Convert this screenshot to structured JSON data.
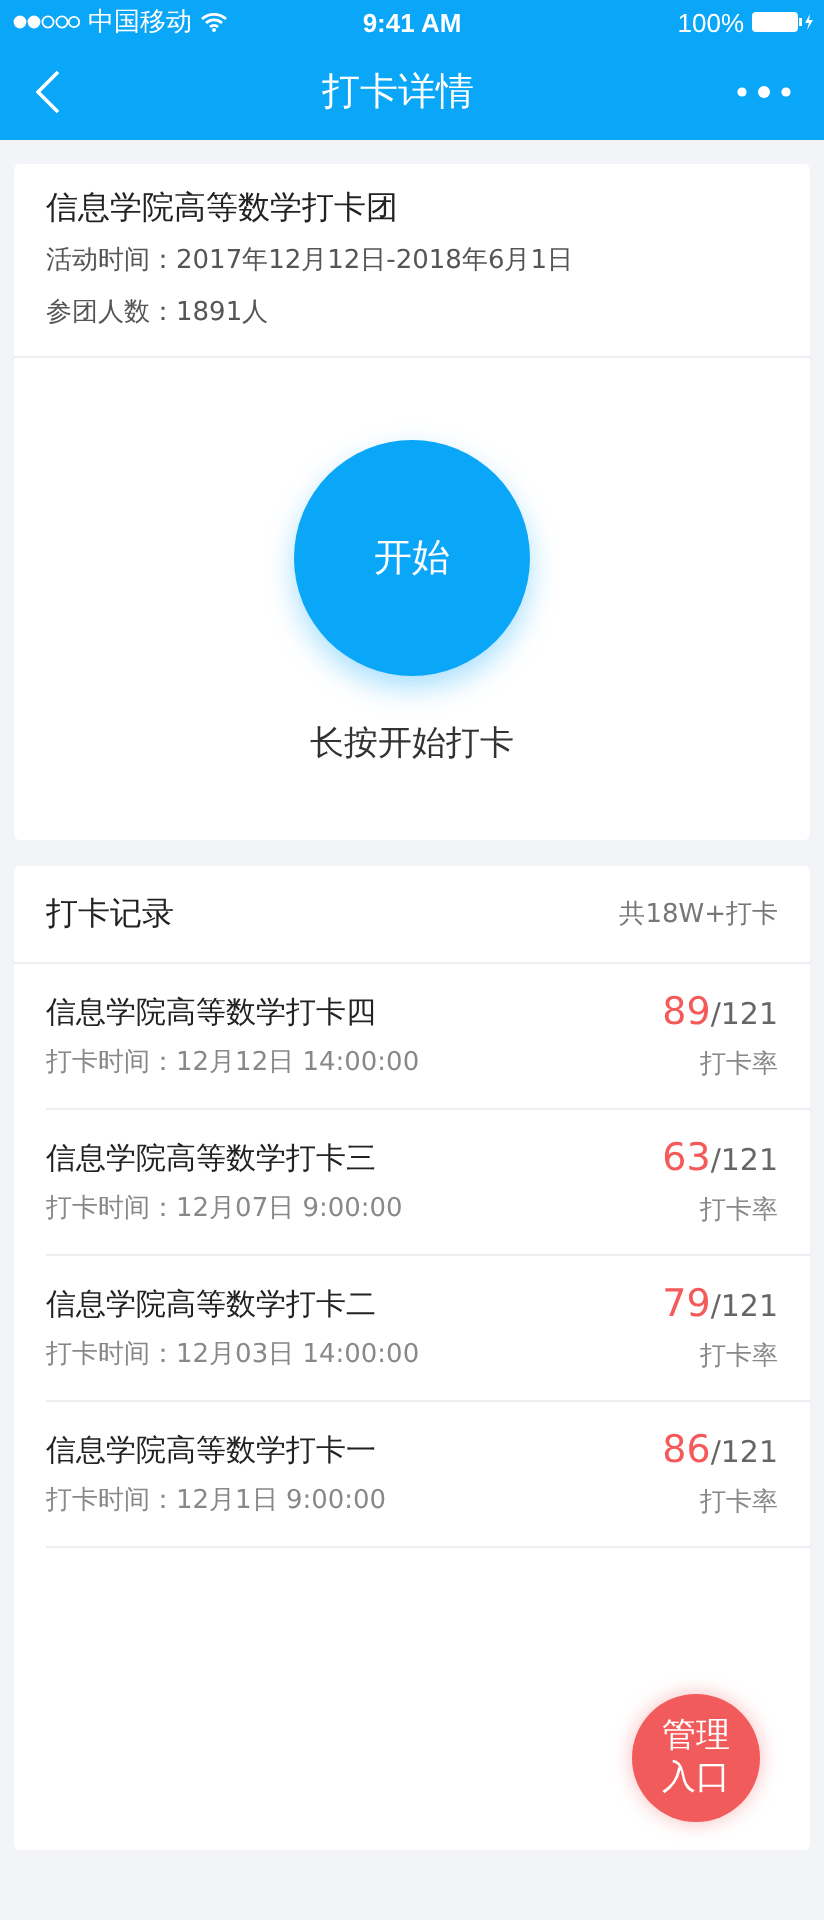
{
  "status_bar": {
    "carrier": "中国移动",
    "time": "9:41 AM",
    "battery": "100%"
  },
  "nav": {
    "title": "打卡详情"
  },
  "group": {
    "name": "信息学院高等数学打卡团",
    "period": "活动时间：2017年12月12日-2018年6月1日",
    "members": "参团人数：1891人"
  },
  "start": {
    "button": "开始",
    "hint": "长按开始打卡"
  },
  "records": {
    "title": "打卡记录",
    "total": "共18W+打卡",
    "items": [
      {
        "name": "信息学院高等数学打卡四",
        "time": "打卡时间：12月12日 14:00:00",
        "count": "89",
        "total": "/121",
        "rate_label": "打卡率"
      },
      {
        "name": "信息学院高等数学打卡三",
        "time": "打卡时间：12月07日 9:00:00",
        "count": "63",
        "total": "/121",
        "rate_label": "打卡率"
      },
      {
        "name": "信息学院高等数学打卡二",
        "time": "打卡时间：12月03日 14:00:00",
        "count": "79",
        "total": "/121",
        "rate_label": "打卡率"
      },
      {
        "name": "信息学院高等数学打卡一",
        "time": "打卡时间：12月1日 9:00:00",
        "count": "86",
        "total": "/121",
        "rate_label": "打卡率"
      }
    ]
  },
  "admin_button": {
    "line1": "管理",
    "line2": "入口"
  }
}
